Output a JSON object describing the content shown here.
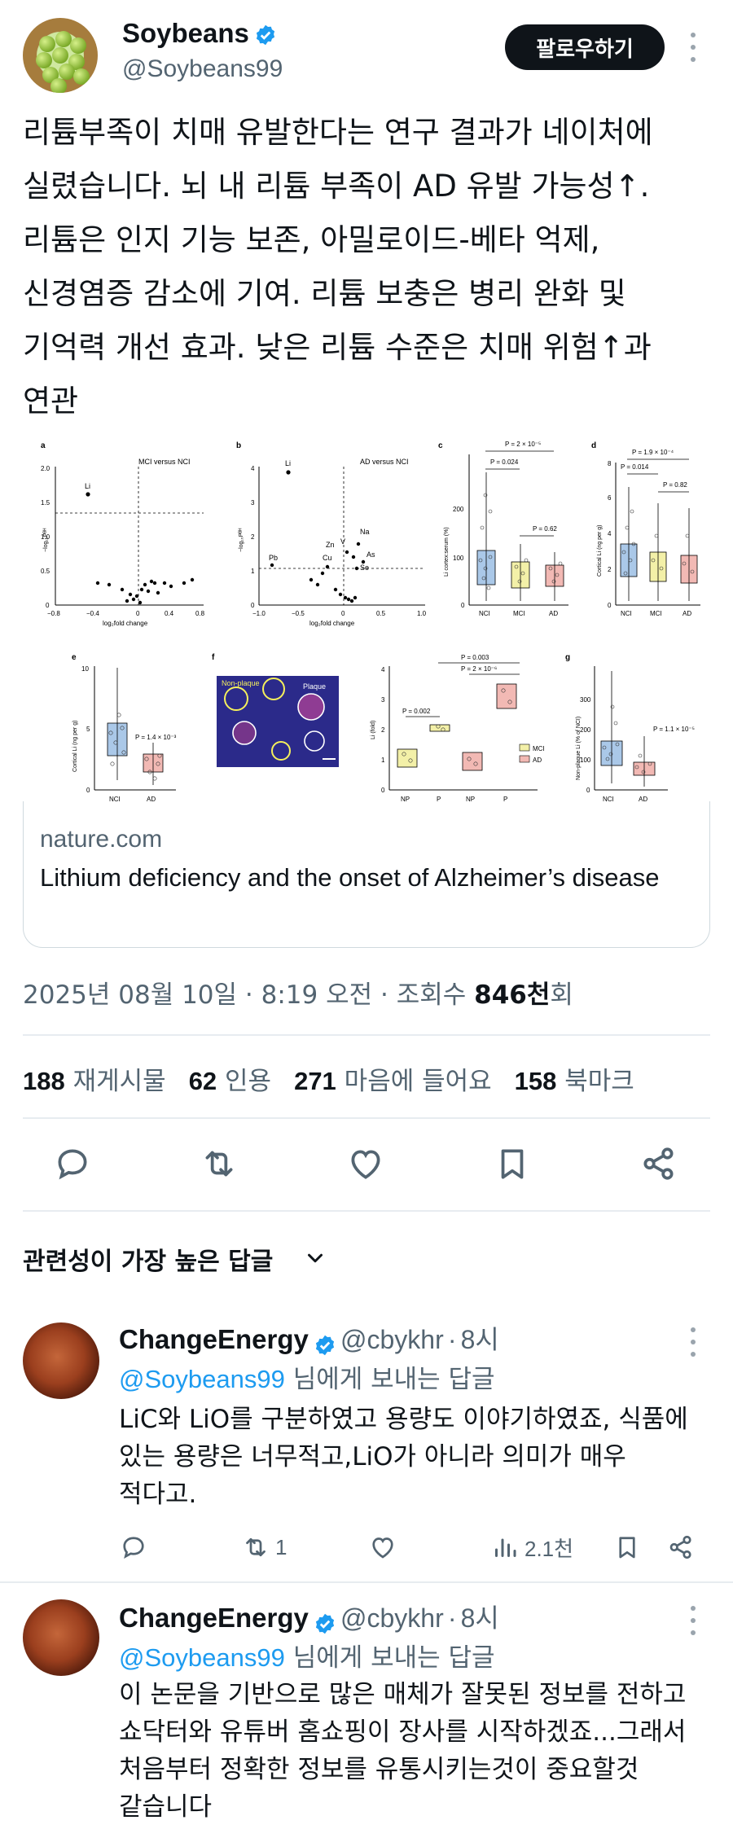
{
  "post": {
    "author": {
      "name": "Soybeans",
      "handle": "@Soybeans99",
      "verified": true
    },
    "follow_label": "팔로우하기",
    "text_lines": [
      "리튬부족이 치매 유발한다는 연구 결과가 네이처에",
      "실렸습니다. 뇌 내 리튬 부족이 AD 유발 가능성↑.",
      "리튬은 인지 기능 보존, 아밀로이드-베타 억제,",
      "신경염증 감소에 기여. 리튬 보충은 병리 완화 및",
      "기억력 개선 효과. 낮은 리튬 수준은 치매 위험↑과",
      "연관"
    ],
    "link_card": {
      "domain": "nature.com",
      "title": "Lithium deficiency and the onset of Alzheimer’s disease"
    },
    "meta": {
      "date": "2025년 08월 10일",
      "time": "8:19 오전",
      "views_label": "조회수",
      "views_value": "846천",
      "views_unit": "회"
    },
    "stats": [
      {
        "count": "188",
        "label": "재게시물"
      },
      {
        "count": "62",
        "label": "인용"
      },
      {
        "count": "271",
        "label": "마음에 들어요"
      },
      {
        "count": "158",
        "label": "북마크"
      }
    ]
  },
  "figure": {
    "panel_a": {
      "letter": "a",
      "title": "MCI versus NCI",
      "xlabel": "log₂fold change",
      "ylabel": "−log₁₀Pᴮᴴ",
      "point_label": "Li",
      "xticks": [
        "−0.8",
        "−0.4",
        "0",
        "0.4",
        "0.8"
      ],
      "yticks": [
        "0",
        "0.5",
        "1.0",
        "1.5",
        "2.0"
      ]
    },
    "panel_b": {
      "letter": "b",
      "title": "AD versus NCI",
      "xlabel": "log₂fold change",
      "ylabel": "−log₁₀Pᴮᴴ",
      "point_labels": [
        "Li",
        "Pb",
        "Na",
        "Zn",
        "V",
        "As",
        "Cu",
        "Se"
      ],
      "xticks": [
        "−1.0",
        "−0.5",
        "0",
        "0.5",
        "1.0"
      ],
      "yticks": [
        "0",
        "1",
        "2",
        "3",
        "4"
      ]
    },
    "panel_c": {
      "letter": "c",
      "ylabel": "Li cortex:serum (%)",
      "groups": [
        "NCI",
        "MCI",
        "AD"
      ],
      "yticks": [
        "0",
        "100",
        "200"
      ],
      "pvals": [
        "P = 2 × 10⁻⁵",
        "P = 0.024",
        "P = 0.62"
      ]
    },
    "panel_d": {
      "letter": "d",
      "ylabel": "Cortical Li (ng per g)",
      "groups": [
        "NCI",
        "MCI",
        "AD"
      ],
      "yticks": [
        "0",
        "2",
        "4",
        "6",
        "8"
      ],
      "pvals": [
        "P = 1.9 × 10⁻⁴",
        "P = 0.014",
        "P = 0.82"
      ]
    },
    "panel_e": {
      "letter": "e",
      "ylabel": "Cortical Li (ng per g)",
      "groups": [
        "NCI",
        "AD"
      ],
      "yticks": [
        "0",
        "5",
        "10"
      ],
      "pval": "P = 1.4 × 10⁻³"
    },
    "panel_f": {
      "letter": "f",
      "labels": [
        "Non-plaque",
        "Plaque"
      ],
      "ylabel": "Li (fold)",
      "groups": [
        "NP",
        "P",
        "NP",
        "P"
      ],
      "yticks": [
        "0",
        "1",
        "2",
        "3",
        "4"
      ],
      "pvals": [
        "P = 0.003",
        "P = 2 × 10⁻⁶",
        "P = 0.002"
      ],
      "legend": [
        "MCI",
        "AD"
      ]
    },
    "panel_g": {
      "letter": "g",
      "ylabel": "Non-plaque Li (% of NCI)",
      "groups": [
        "NCI",
        "AD"
      ],
      "yticks": [
        "0",
        "100",
        "200",
        "300"
      ],
      "pval": "P = 1.1 × 10⁻⁵"
    }
  },
  "replies_header": "관련성이 가장 높은 답글",
  "replies": [
    {
      "name": "ChangeEnergy",
      "handle": "@cbykhr",
      "time": "8시",
      "reply_prefix": "@Soybeans99",
      "reply_suffix": "님에게 보내는 답글",
      "text_lines": [
        "LiC와 LiO를 구분하였고 용량도 이야기하였죠, 식품에",
        "있는 용량은 너무적고,LiO가 아니라 의미가 매우",
        "적다고."
      ],
      "retweets": "1",
      "views": "2.1천"
    },
    {
      "name": "ChangeEnergy",
      "handle": "@cbykhr",
      "time": "8시",
      "reply_prefix": "@Soybeans99",
      "reply_suffix": "님에게 보내는 답글",
      "text_lines": [
        "이 논문을 기반으로 많은 매체가 잘못된 정보를 전하고",
        "쇼닥터와 유튜버 홈쇼핑이 장사를 시작하겠죠...그래서",
        "처음부터 정확한 정보를 유통시키는것이 중요할것",
        "같습니다"
      ]
    }
  ],
  "colors": {
    "accent": "#1d9bf0",
    "text": "#0f1419",
    "secondary": "#536471",
    "divider": "#e7ecf0"
  }
}
